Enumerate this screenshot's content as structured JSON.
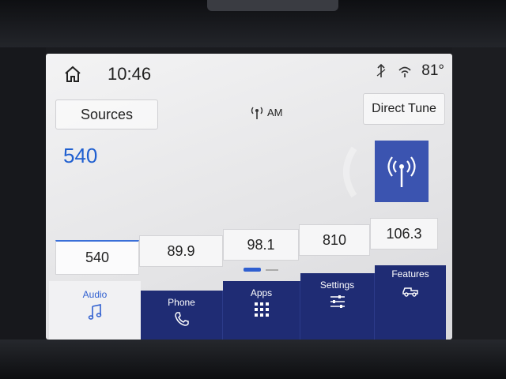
{
  "status": {
    "time": "10:46",
    "temperature": "81°"
  },
  "radio": {
    "sources_label": "Sources",
    "current_frequency": "540",
    "band": "AM",
    "direct_tune_label": "Direct Tune"
  },
  "presets": [
    {
      "label": "540",
      "active": true
    },
    {
      "label": "89.9",
      "active": false
    },
    {
      "label": "98.1",
      "active": false
    },
    {
      "label": "810",
      "active": false
    },
    {
      "label": "106.3",
      "active": false
    }
  ],
  "nav": {
    "audio": "Audio",
    "phone": "Phone",
    "apps": "Apps",
    "settings": "Settings",
    "features": "Features"
  },
  "colors": {
    "accent": "#2f5fd0",
    "nav_bg": "#1f2c74",
    "radio_tile": "#3b54b0"
  },
  "icons": [
    "home-icon",
    "antenna-icon",
    "wifi-icon",
    "radio-tower-icon",
    "music-note-icon",
    "phone-icon",
    "apps-grid-icon",
    "sliders-icon",
    "truck-icon"
  ]
}
